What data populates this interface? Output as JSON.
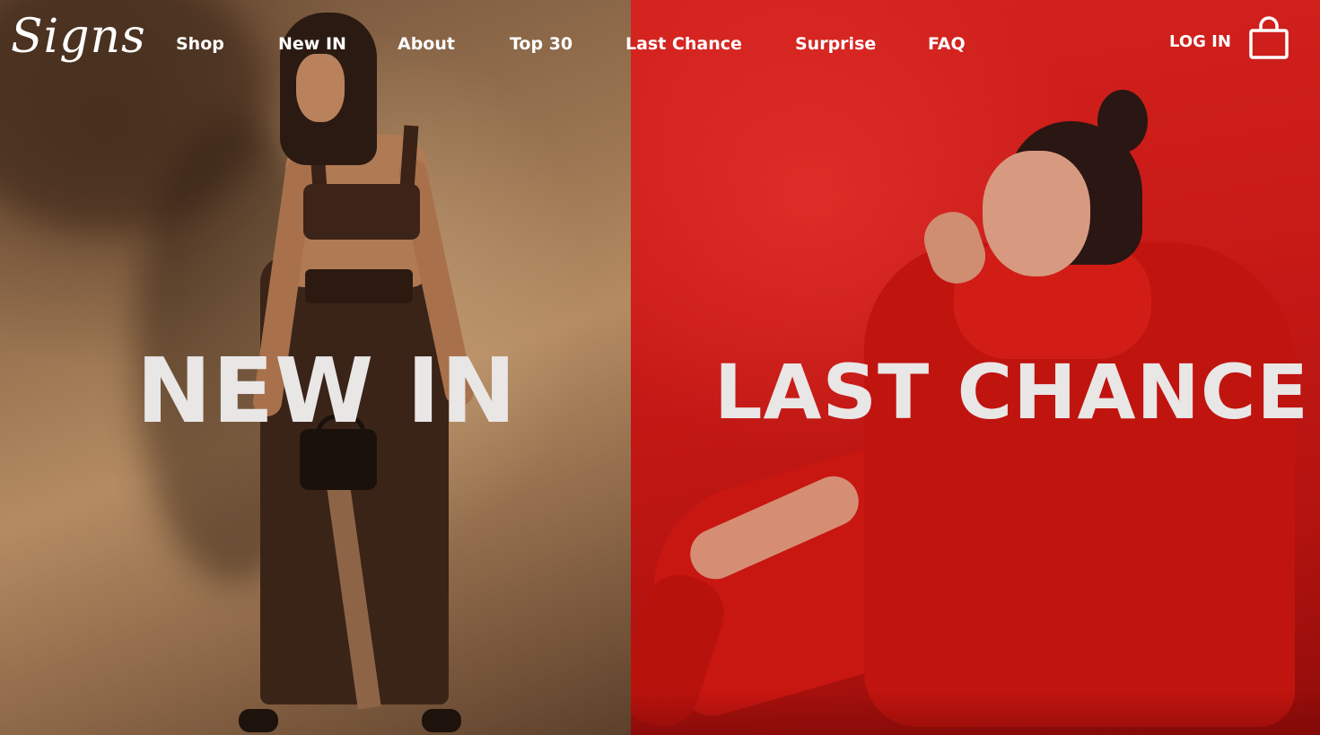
{
  "brand": {
    "logo_text": "Signs"
  },
  "nav": {
    "items": [
      {
        "label": "Shop"
      },
      {
        "label": "New IN"
      },
      {
        "label": "About"
      },
      {
        "label": "Top 30"
      },
      {
        "label": "Last Chance"
      },
      {
        "label": "Surprise"
      },
      {
        "label": "FAQ"
      }
    ],
    "login_label": "LOG IN",
    "cart_icon": "shopping-bag-icon"
  },
  "hero": {
    "left": {
      "title": "NEW IN",
      "image": "model in brown leather outfit",
      "accent": "#9c7652"
    },
    "right": {
      "title": "LAST CHANCE",
      "image": "model in red coat sitting",
      "accent": "#c81a17"
    }
  },
  "colors": {
    "nav_text": "#ffffff",
    "hero_title": "#e9e6e6"
  }
}
